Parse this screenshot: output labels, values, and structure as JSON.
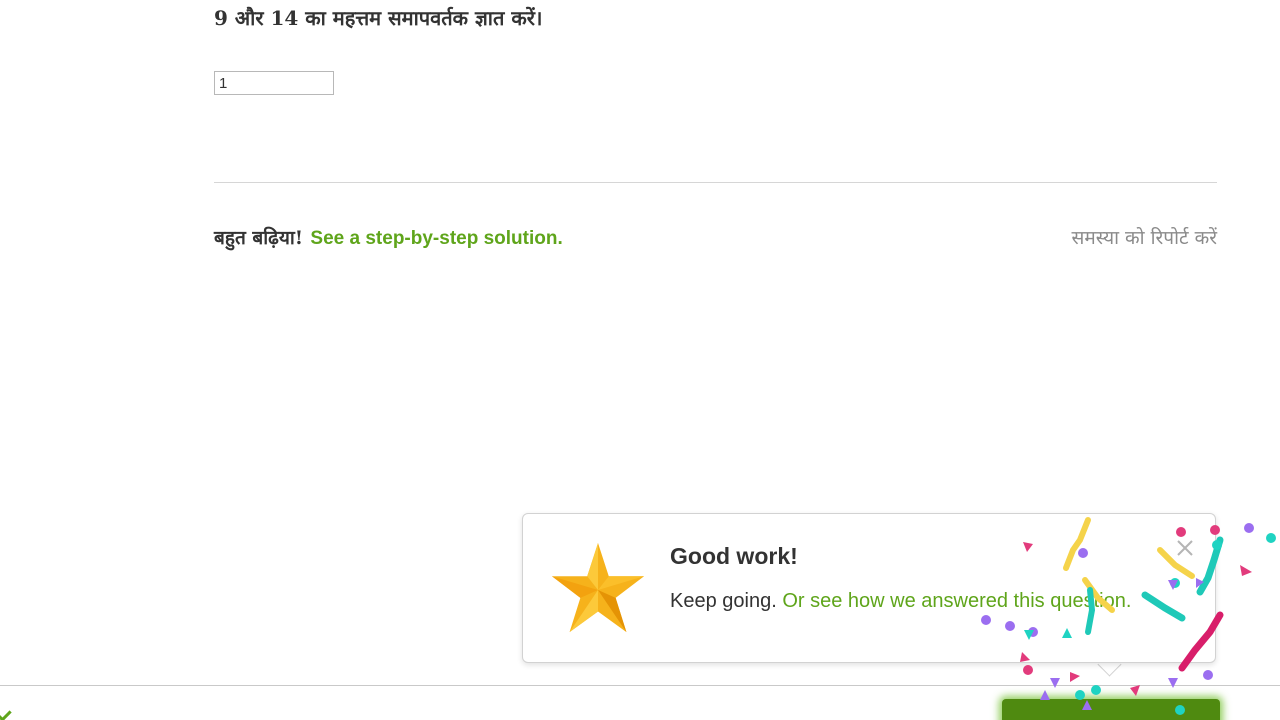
{
  "question": {
    "text": "9 और 14 का महत्तम समापवर्तक ज्ञात करें।"
  },
  "answer": {
    "value": "1"
  },
  "feedback": {
    "praise": "बहुत बढ़िया!",
    "solution_link": "See a step-by-step solution.",
    "report_link": "समस्या को रिपोर्ट करें"
  },
  "popover": {
    "title": "Good work!",
    "body_prefix": "Keep going.",
    "body_link": "Or see how we answered this question.",
    "icon": "star-icon"
  },
  "colors": {
    "accent_green": "#5fa51b",
    "button_green": "#4f8a10",
    "star_gold": "#f6b21b"
  }
}
